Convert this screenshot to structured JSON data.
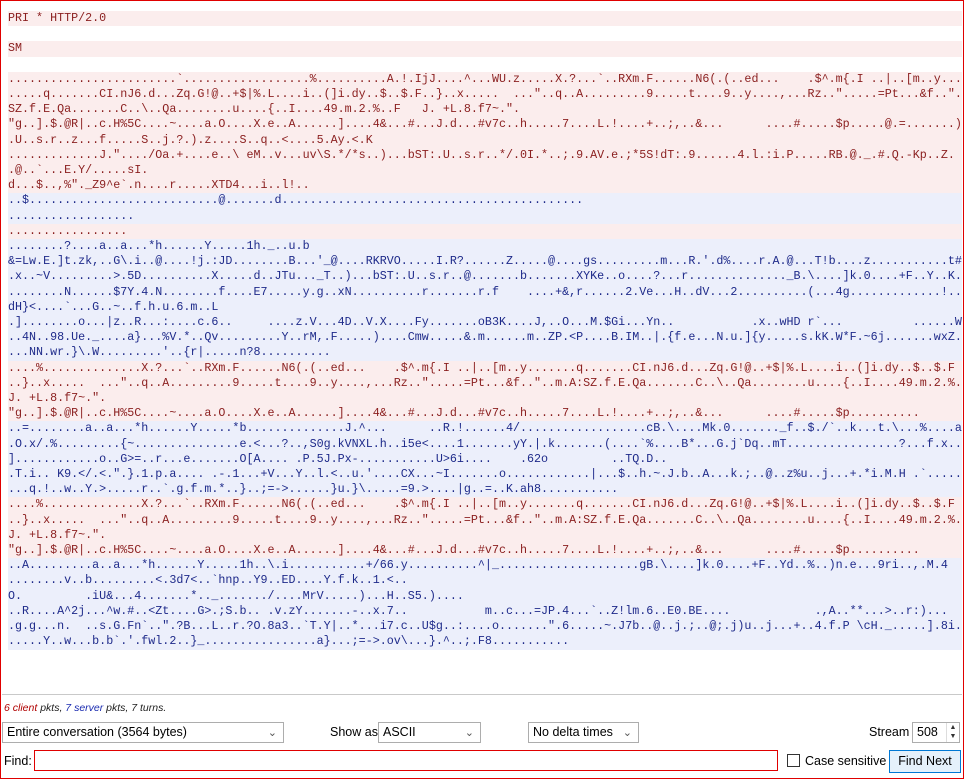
{
  "stream_view": {
    "lines": [
      {
        "type": "client",
        "text": "PRI * HTTP/2.0"
      },
      {
        "type": "gap"
      },
      {
        "type": "client",
        "text": "SM"
      },
      {
        "type": "gap"
      },
      {
        "type": "client",
        "text": "........................`..................%..........A.!.IjJ....^...WU.z.....X.?...`..RXm.F......N6(.(..ed...    .$^.m{.I ..|..[m..y...\n.....q.......CI.nJ6.d...Zq.G!@..+$|%.L....i..(]i.dy..$..$.F..}..x.....  ...\"..q..A.........9.....t....9..y....,...Rz..\".....=Pt...&f..\"..m.A:\nSZ.f.E.Qa.......C..\\..Qa........u....{..I....49.m.2.%..F   J. +L.8.f7~.\".\n\"g..].$.@R|..c.H%5C....~....a.O....X.e..A......]....4&...#...J.d...#v7c..h.....7....L.!....+..;,..&...      ....#.....$p.....@.=.......)...bST:\n.U..s.r..z...f.....S..j.?.).z....S..q..<....5.Ay.<.K\n.............J.\"..../Oa.+....e..\\ eM..v...uv\\S.*/*s..)...bST:.U..s.r..*/.0I.*..;.9.AV.e.;*5S!dT:.9......4.l.:i.P.....RB.@._.#.Q.-Kp..Z.\n.@..`...E.Y/.....sI.\nd...$..,%\"._Z9^e`.n....r.....XTD4...i..l!.."
      },
      {
        "type": "server",
        "text": "..$...........................@.......d...........................................\n.................."
      },
      {
        "type": "client",
        "text": "................."
      },
      {
        "type": "server",
        "text": "........?....a..a...*h......Y.....1h._..u.b\n&=Lw.E.]t.zk,..G\\.i..@....!j.:JD........B...'_@....RKRVO.....I.R?......Z.....@....gs.........m...R.'.d%....r.A.@...T!b....z...........t#.M.\n.x..~V.........>.5D..........X.....d..JTu..._T..)...bST:.U..s.r..@.......b.......XYKe..o....?...r.............._B.\\....]k.0....+F..Y..K.\n........N......$7Y.4.N........f....E7.....y.g..xN..........r.......r.f    ....+&,r......2.Ve...H..dV...2..........(...4g.............!.....*h\ndH}<....`...G..~..f.h.u.6.m..L\n.]........o...|z..R...:....c.6..     ....z.V...4D..V.X....Fy.......oB3K....J,..O...M.$Gi...Yn..           .x..wHD r`...          ......W...\n..4N..98.Ue._....a}...%V.*..Qv.........Y..rM,.F.....)....Cmw.....&.m......m..ZP.<P....B.IM..|.{f.e...N.u.]{y.....s.kK.W*F.~6j.......wxZ.....\n...NN.wr.}\\.W.........'..{r|.....n?8.........."
      },
      {
        "type": "client",
        "text": "....%..............X.?...`..RXm.F......N6(.(..ed...    .$^.m{.I ..|..[m..y.......q.......CI.nJ6.d...Zq.G!@..+$|%.L....i..(]i.dy..$..$.F\n..}..x.....  ...\"..q..A.........9.....t....9..y....,...Rz..\".....=Pt...&f..\"..m.A:SZ.f.E.Qa.......C..\\..Qa........u....{..I....49.m.2.%..F\nJ. +L.8.f7~.\".\n\"g..].$.@R|..c.H%5C....~....a.O....X.e..A......]....4&...#...J.d...#v7c..h.....7....L.!....+..;,..&...      ....#.....$p.........."
      },
      {
        "type": "server",
        "text": "..=........a..a...*h......Y.....*b..............J.^...      ..R.!......4/..................cB.\\....Mk.0......._f..$./`..k...t.\\...%....av..\n.O.x/.%.........{~...............e.<...?..,S0g.kVNXL.h..i5e<....1.......yY.|.k.......(....`%....B*...G.j`Dq..mT................?...f.x....v\n]............o..G>=..r...e.......O[A.... .P.5J.Px-...........U>6i....    .62o         ..TQ.D..\n.T.i.. K9.</.<.\".}.1.p.a.... .-.1...+V...Y..l.<..u.'....CX...~I.......o............|...$..h.~.J.b..A...k.;..@..z%u..j...+.*i.M.H .`.....|._\n...q.!..w..Y.>.....r..`.g.f.m.*..}..;=->......}u.}\\.....=9.>....|g..=..K.ah8..........."
      },
      {
        "type": "client",
        "text": "....%..............X.?...`..RXm.F......N6(.(..ed...    .$^.m{.I ..|..[m..y.......q.......CI.nJ6.d...Zq.G!@..+$|%.L....i..(]i.dy..$..$.F\n..}..x.....  ...\"..q..A.........9.....t....9..y....,...Rz..\".....=Pt...&f..\"..m.A:SZ.f.E.Qa.......C..\\..Qa........u....{..I....49.m.2.%..F\nJ. +L.8.f7~.\".\n\"g..].$.@R|..c.H%5C....~....a.O....X.e..A......]....4&...#...J.d...#v7c..h.....7....L.!....+..;,..&...      ....#.....$p.........."
      },
      {
        "type": "server",
        "text": "..A.........a..a...*h......Y.....1h..\\.i...........+/66.y..........^|_....................gB.\\....]k.0....+F..Yd..%..)n.e...9ri..,.M.4\n........v..b.........<.3d7<..`hnp..Y9..ED....Y.f.k..1.<..\nO.         .iU&...4.......*.._......./....MrV.....)...H..S5.)....\n..R....A^2j...^w.#..<Zt....G>.;S.b.. .v.zY.......-..x.7..           m..c...=JP.4...`..Z!lm.6..E0.BE....            .,A..**...>..r:)...\n.g.g...n.  ..s.G.Fn`..\".?B...L..r.?O.8a3..`T.Y|..*...i7.c..U$g..:....o.......\".6.....~.J7b..@..j.;..@;.j)u..j...+..4.f.P \\cH._.....].8i....\n.....Y..w...b.b`.'.fwl.2..}_................a}...;=->.ov\\...}.^..;.F8..........."
      }
    ]
  },
  "summary": {
    "client_count": "6",
    "client_word": "client",
    "pkts1": " pkts, ",
    "server_count": "7",
    "server_word": "server",
    "pkts2": " pkts, 7 turns."
  },
  "controls": {
    "conversation_select": "Entire conversation (3564 bytes)",
    "show_as_label": "Show as",
    "show_as_value": "ASCII",
    "delta_select": "No delta times",
    "stream_label": "Stream",
    "stream_value": "508",
    "find_label": "Find:",
    "find_value": "",
    "case_sensitive_label": "Case sensitive",
    "find_next_label": "Find Next"
  },
  "colors": {
    "client_fg": "#8a1e1e",
    "client_bg": "#fbeded",
    "server_fg": "#1e2a8a",
    "server_bg": "#eceffb",
    "frame": "#e00000"
  }
}
